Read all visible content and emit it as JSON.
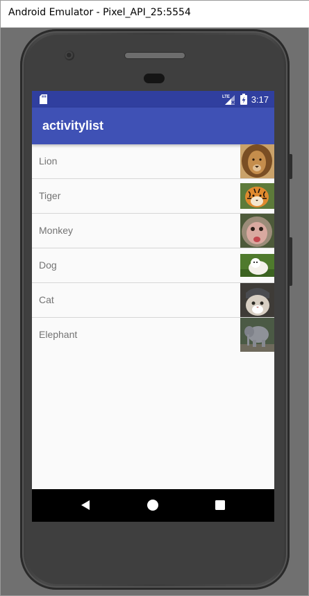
{
  "window": {
    "title": "Android Emulator - Pixel_API_25:5554"
  },
  "status_bar": {
    "time": "3:17",
    "network": "LTE",
    "icons": [
      "sd-card-icon",
      "signal-icon",
      "battery-charging-icon"
    ]
  },
  "app_bar": {
    "title": "activitylist"
  },
  "list": {
    "items": [
      {
        "label": "Lion",
        "image": "lion-image"
      },
      {
        "label": "Tiger",
        "image": "tiger-image"
      },
      {
        "label": "Monkey",
        "image": "monkey-image"
      },
      {
        "label": "Dog",
        "image": "dog-image"
      },
      {
        "label": "Cat",
        "image": "cat-image"
      },
      {
        "label": "Elephant",
        "image": "elephant-image"
      }
    ]
  },
  "nav_bar": {
    "buttons": [
      "back-icon",
      "home-icon",
      "recents-icon"
    ]
  },
  "colors": {
    "primary": "#3f51b5",
    "primary_dark": "#303f9f",
    "background": "#fafafa"
  }
}
